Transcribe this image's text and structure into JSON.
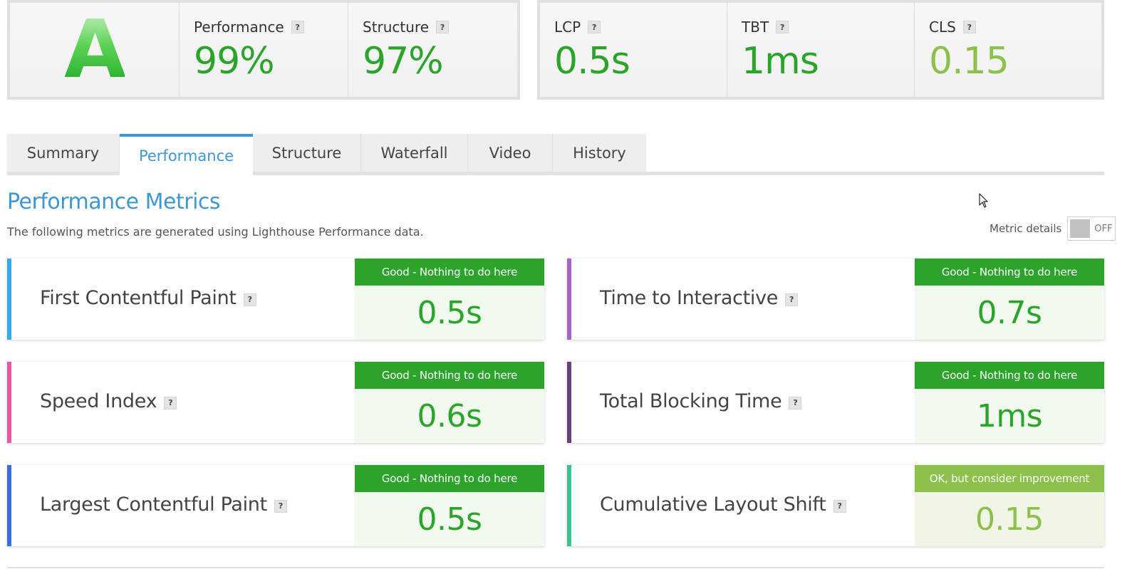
{
  "grade": {
    "letter": "A"
  },
  "scores": [
    {
      "label": "Performance",
      "value": "99%"
    },
    {
      "label": "Structure",
      "value": "97%"
    }
  ],
  "vitals": [
    {
      "label": "LCP",
      "value": "0.5s",
      "status": "good"
    },
    {
      "label": "TBT",
      "value": "1ms",
      "status": "good"
    },
    {
      "label": "CLS",
      "value": "0.15",
      "status": "ok"
    }
  ],
  "help_glyph": "?",
  "tabs": [
    {
      "label": "Summary",
      "active": false
    },
    {
      "label": "Performance",
      "active": true
    },
    {
      "label": "Structure",
      "active": false
    },
    {
      "label": "Waterfall",
      "active": false
    },
    {
      "label": "Video",
      "active": false
    },
    {
      "label": "History",
      "active": false
    }
  ],
  "section": {
    "title": "Performance Metrics",
    "description": "The following metrics are generated using Lighthouse Performance data.",
    "toggle_label": "Metric details",
    "toggle_state": "OFF"
  },
  "metrics": [
    {
      "name": "First Contentful Paint",
      "status": "Good - Nothing to do here",
      "value": "0.5s",
      "level": "good",
      "accent": "#3aa8e6"
    },
    {
      "name": "Time to Interactive",
      "status": "Good - Nothing to do here",
      "value": "0.7s",
      "level": "good",
      "accent": "#a565c9"
    },
    {
      "name": "Speed Index",
      "status": "Good - Nothing to do here",
      "value": "0.6s",
      "level": "good",
      "accent": "#e55a9e"
    },
    {
      "name": "Total Blocking Time",
      "status": "Good - Nothing to do here",
      "value": "1ms",
      "level": "good",
      "accent": "#6b3f7a"
    },
    {
      "name": "Largest Contentful Paint",
      "status": "Good - Nothing to do here",
      "value": "0.5s",
      "level": "good",
      "accent": "#3a6fd6"
    },
    {
      "name": "Cumulative Layout Shift",
      "status": "OK, but consider improvement",
      "value": "0.15",
      "level": "ok",
      "accent": "#3fbf94"
    }
  ],
  "colors": {
    "good": "#2ca42c",
    "ok": "#8cc14c",
    "link": "#3d97d4"
  }
}
